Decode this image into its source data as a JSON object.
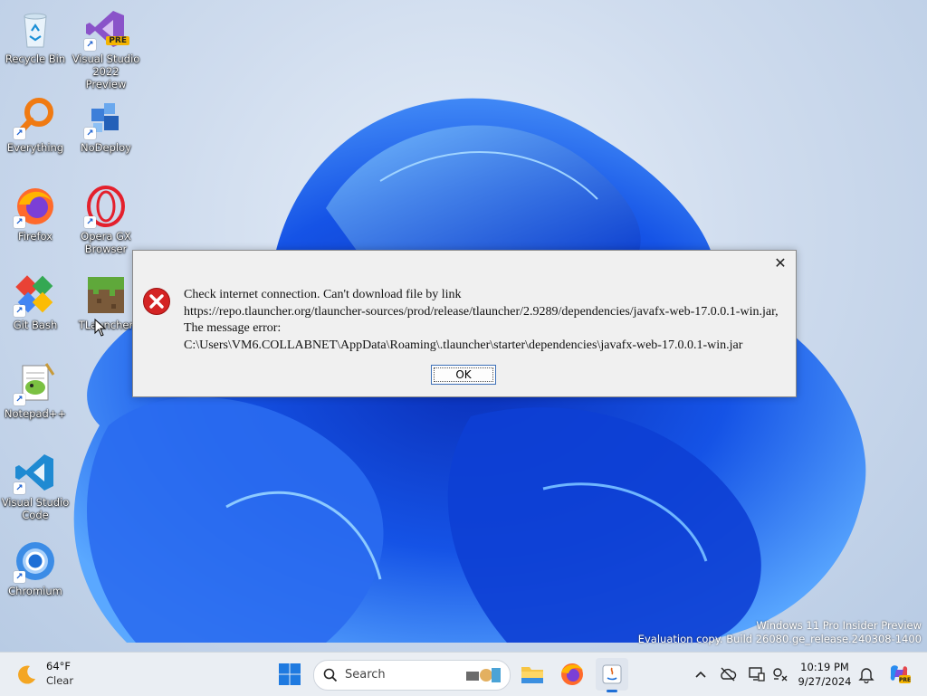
{
  "desktop": {
    "icons": [
      {
        "label": "Recycle Bin",
        "icon": "recycle-bin-icon"
      },
      {
        "label": "Visual Studio 2022 Preview",
        "icon": "visual-studio-icon",
        "badge": "PRE"
      },
      {
        "label": "Everything",
        "icon": "everything-search-icon"
      },
      {
        "label": "NoDeploy",
        "icon": "nodeploy-icon"
      },
      {
        "label": "Firefox",
        "icon": "firefox-icon"
      },
      {
        "label": "Opera GX Browser",
        "icon": "opera-gx-icon"
      },
      {
        "label": "Git Bash",
        "icon": "git-bash-icon"
      },
      {
        "label": "TLauncher",
        "icon": "minecraft-grass-icon"
      },
      {
        "label": "Notepad++",
        "icon": "notepad-plus-plus-icon"
      },
      {
        "label": "Visual Studio Code",
        "icon": "vscode-icon"
      },
      {
        "label": "Chromium",
        "icon": "chromium-icon"
      }
    ],
    "watermark": {
      "line1": "Windows 11 Pro Insider Preview",
      "line2": "Evaluation copy. Build 26080.ge_release.240308-1400"
    }
  },
  "dialog": {
    "message": "Check internet connection. Can't download file by link\nhttps://repo.tlauncher.org/tlauncher-sources/prod/release/tlauncher/2.9289/dependencies/javafx-web-17.0.0.1-win.jar,\nThe message error:\nC:\\Users\\VM6.COLLABNET\\AppData\\Roaming\\.tlauncher\\starter\\dependencies\\javafx-web-17.0.0.1-win.jar",
    "ok_label": "OK",
    "close_glyph": "✕",
    "icon": "error-icon"
  },
  "taskbar": {
    "weather": {
      "temp": "64°F",
      "condition": "Clear",
      "icon": "moon-weather-icon"
    },
    "search_placeholder": "Search",
    "pinned": [
      "file-explorer-icon",
      "firefox-icon",
      "java-app-icon"
    ],
    "clock": {
      "time": "10:19 PM",
      "date": "9/27/2024"
    },
    "tray": [
      "chevron-up-icon",
      "cloud-offline-icon",
      "display-icon",
      "network-sound-icon",
      "bell-icon",
      "copilot-icon"
    ]
  },
  "colors": {
    "error_red": "#d42424",
    "accent_blue": "#1e5fd9",
    "dialog_bg": "#f0f0f0"
  }
}
